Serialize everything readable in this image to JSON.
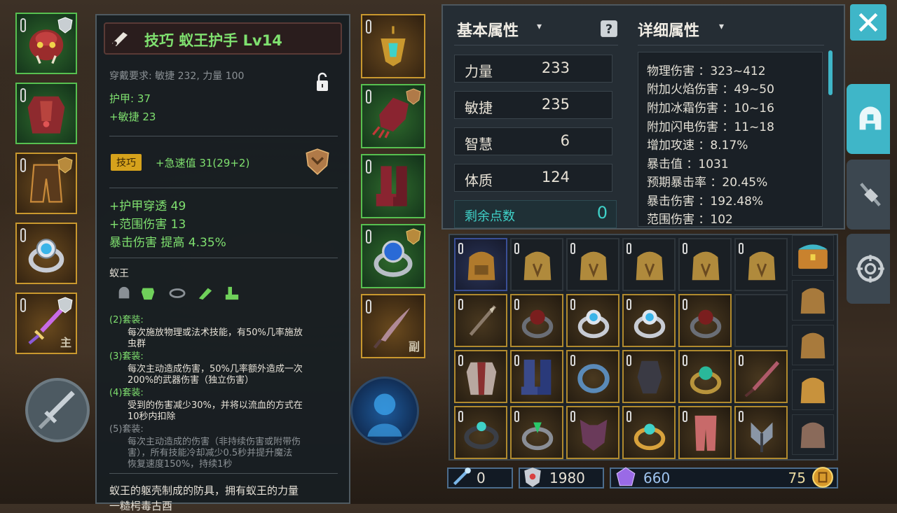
{
  "colors": {
    "green_text": "#7fe06f",
    "gold_border": "#c9982e",
    "accent_cyan": "#3fd1c8"
  },
  "tooltip": {
    "title": "技巧 蚁王护手 Lv14",
    "requirement": "穿戴要求:  敏捷 232, 力量 100",
    "armor": "护甲:  37",
    "agility_bonus": "+敏捷 23",
    "skill_badge": "技巧",
    "skill_bonus": "+急速值 31(29+2)",
    "bonus1": "+护甲穿透  49",
    "bonus2": "+范围伤害  13",
    "bonus3": "暴击伤害  提高  4.35%",
    "set_name": "蚁王",
    "set2_title": "(2)套装:",
    "set2_desc_1": "每次施放物理或法术技能，有50%几率施放",
    "set2_desc_2": "虫群",
    "set3_title": "(3)套装:",
    "set3_desc_1": "每次主动造成伤害，50%几率额外造成一次",
    "set3_desc_2": "200%的武器伤害（独立伤害）",
    "set4_title": "(4)套装:",
    "set4_desc_1": "受到的伤害减少30%，并将以流血的方式在",
    "set4_desc_2": "10秒内扣除",
    "set5_title": "(5)套装:",
    "set5_desc_1": "每次主动造成的伤害（非持续伤害或附带伤",
    "set5_desc_2": "害），所有技能冷却减少0.5秒并提升魔法",
    "set5_desc_3": "恢复速度150%，持续1秒",
    "flavor_1": "蚁王的躯壳制成的防具，拥有蚁王的力量",
    "flavor_2": "一糙枵毒古酉"
  },
  "equipment": {
    "main_tag": "主",
    "off_tag": "副"
  },
  "stats": {
    "basic_title": "基本属性",
    "detail_title": "详细属性",
    "basic": [
      {
        "name": "力量",
        "value": "233"
      },
      {
        "name": "敏捷",
        "value": "235"
      },
      {
        "name": "智慧",
        "value": "6"
      },
      {
        "name": "体质",
        "value": "124"
      }
    ],
    "remaining_label": "剩余点数",
    "remaining_value": "0",
    "detail": [
      "物理伤害 ：323~412",
      "附加火焰伤害 ：49~50",
      "附加冰霜伤害 ：10~16",
      "附加闪电伤害 ：11~18",
      "增加攻速 ：8.17%",
      "暴击值 ：1031",
      "预期暴击率 ：20.45%",
      "暴击伤害 ：192.48%",
      "范围伤害 ：102"
    ]
  },
  "currency": {
    "shards": "0",
    "silver": "1980",
    "crystals": "660",
    "gold": "75"
  }
}
